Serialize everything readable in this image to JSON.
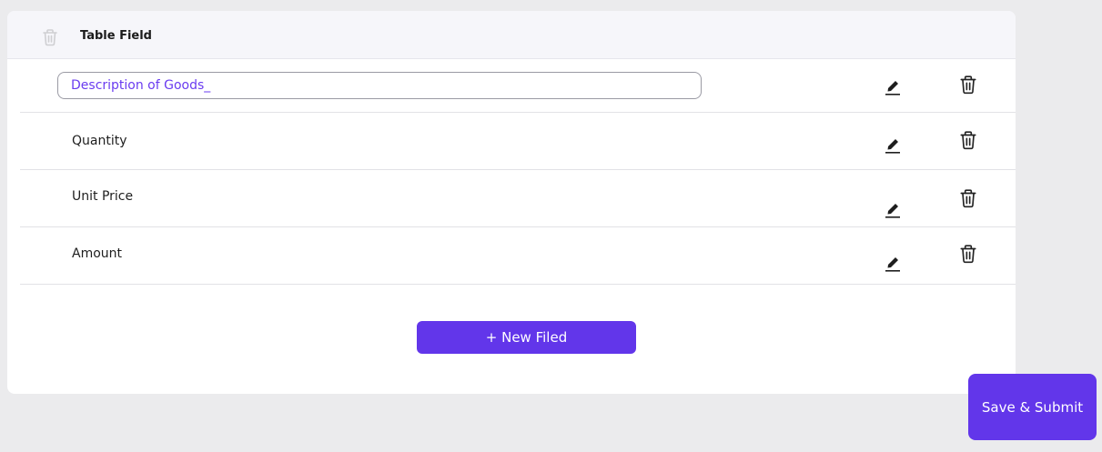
{
  "header": {
    "title": "Table Field",
    "icon": "trash-icon"
  },
  "rows": [
    {
      "type": "input",
      "value": "Description of Goods_",
      "edit_icon": "pencil-icon",
      "delete_icon": "trash-icon"
    },
    {
      "type": "label",
      "label": "Quantity",
      "edit_icon": "pencil-icon",
      "delete_icon": "trash-icon"
    },
    {
      "type": "label",
      "label": "Unit Price",
      "edit_icon": "pencil-icon",
      "delete_icon": "trash-icon"
    },
    {
      "type": "label",
      "label": "Amount",
      "edit_icon": "pencil-icon",
      "delete_icon": "trash-icon"
    }
  ],
  "buttons": {
    "new_field": "+ New Filed",
    "save_submit": "Save & Submit"
  },
  "colors": {
    "accent": "#6236ea",
    "input_text": "#6a3cf0",
    "background": "#ebebed",
    "card": "#ffffff",
    "header_bg": "#f6f6fa"
  }
}
